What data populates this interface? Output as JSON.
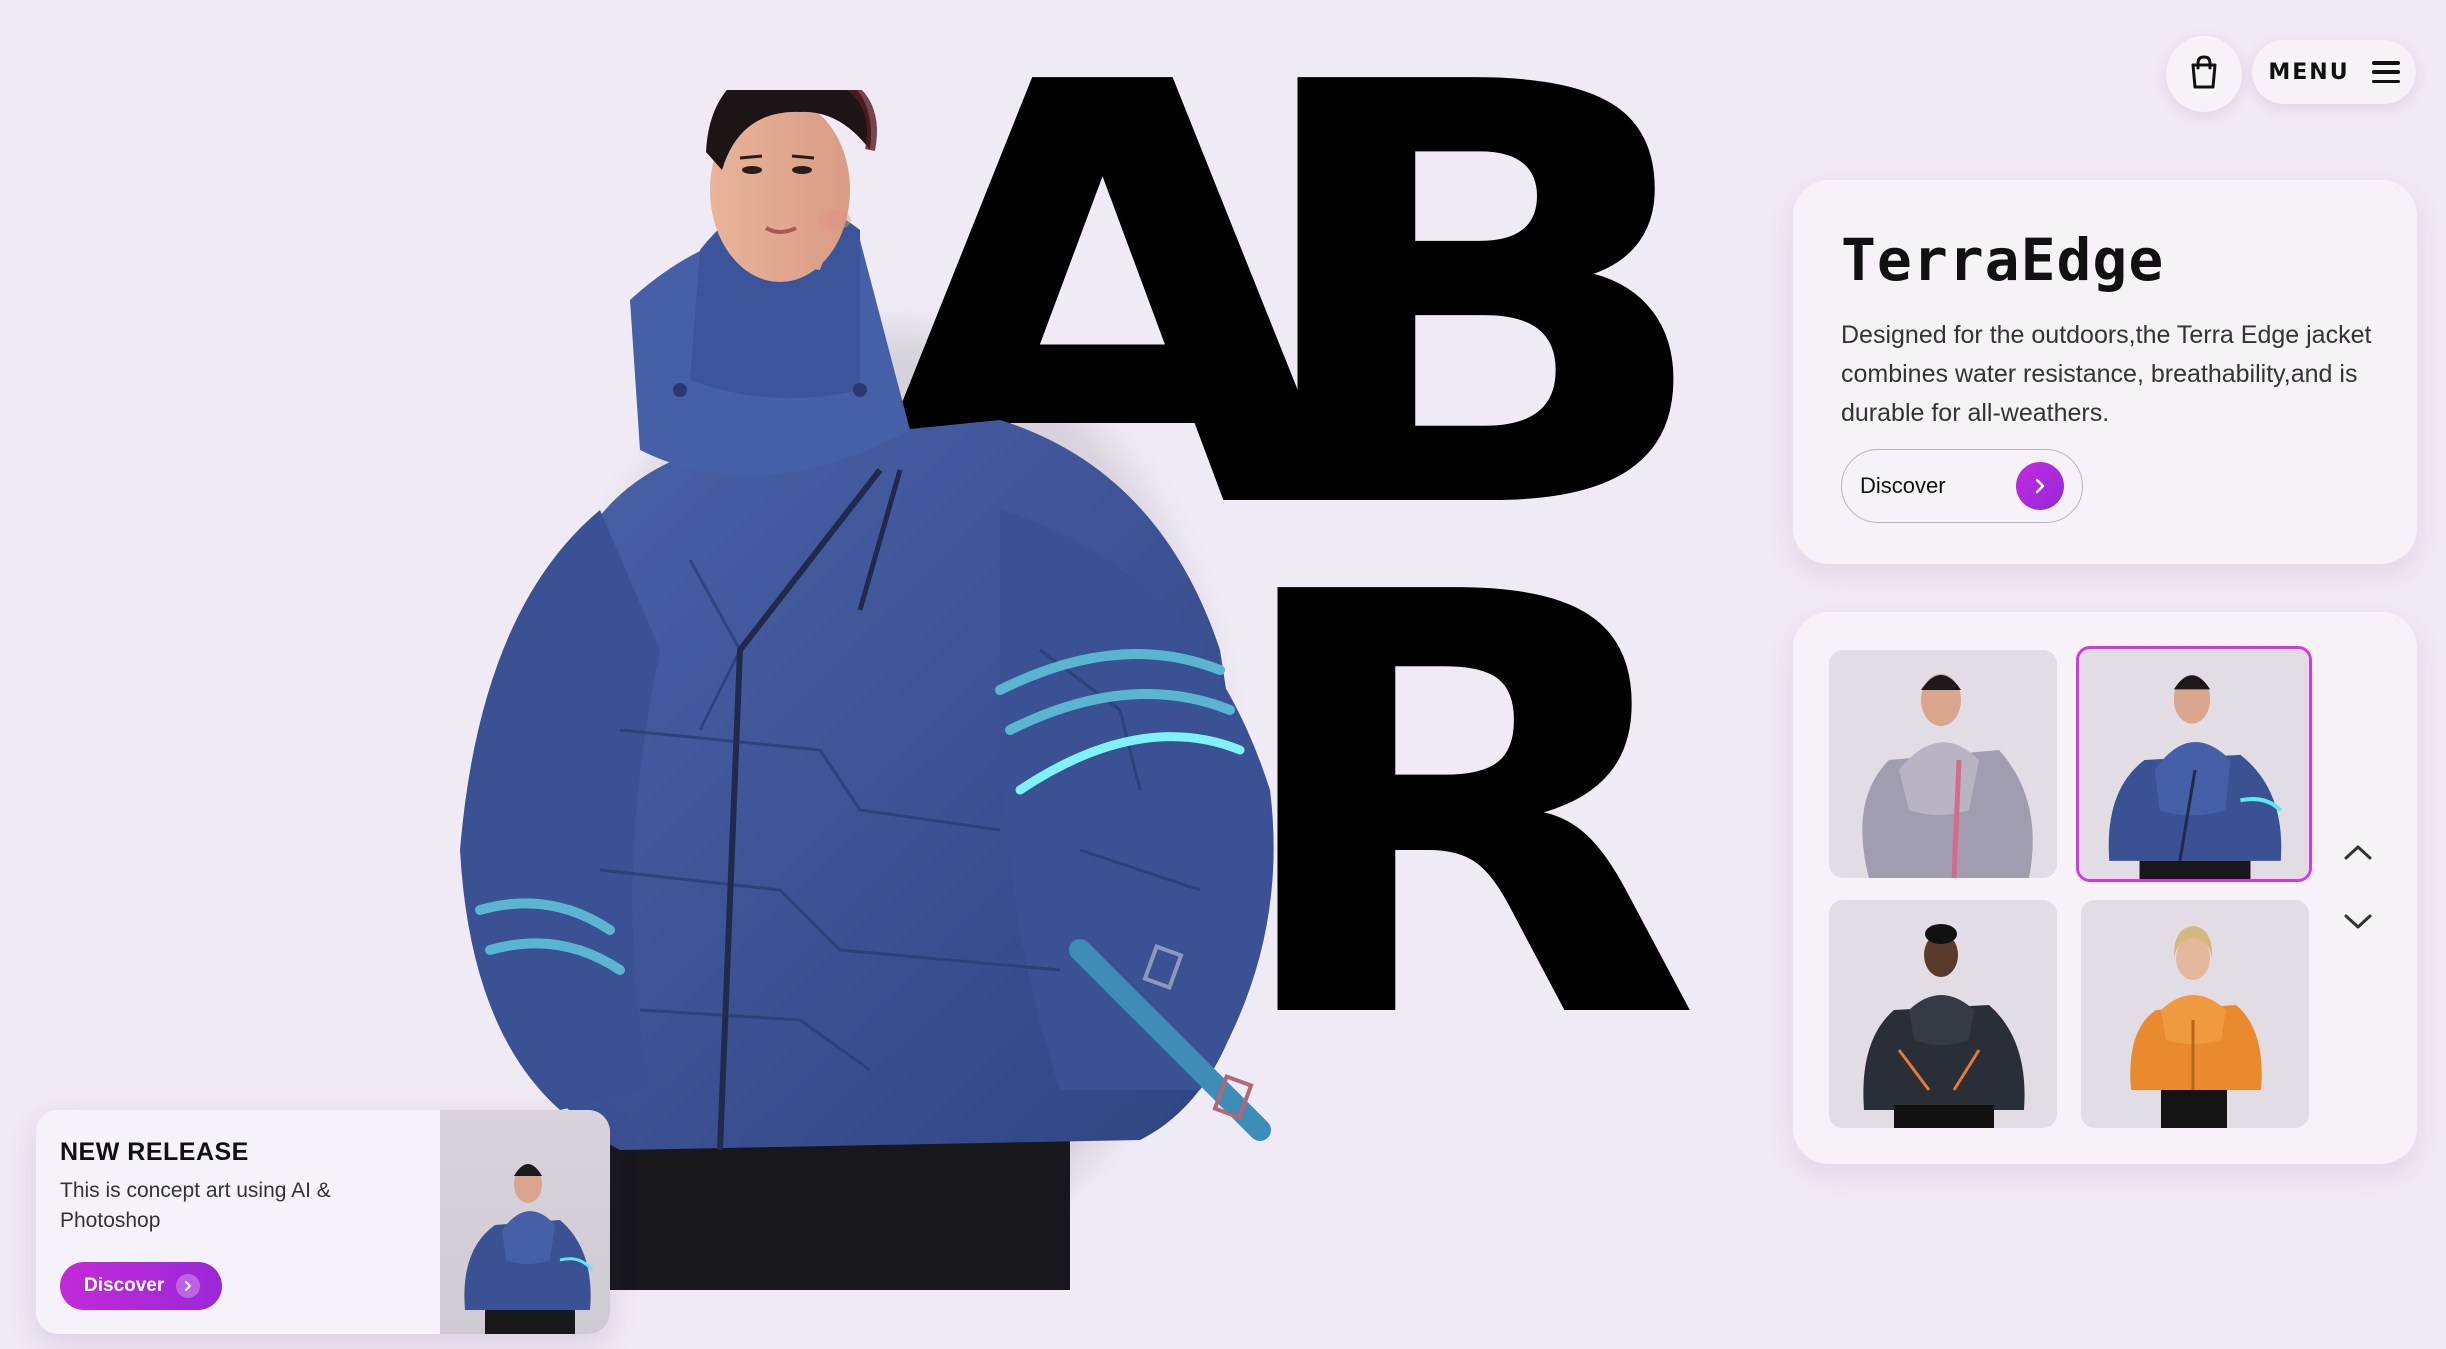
{
  "hero": {
    "letters": [
      "A",
      "B",
      "R"
    ]
  },
  "header": {
    "cart_icon": "shopping-bag-icon",
    "menu_label": "MENU",
    "menu_icon": "hamburger-icon"
  },
  "product": {
    "title": "TerraEdge",
    "description": "Designed for the outdoors,the Terra Edge jacket combines water resistance, breathability,and is durable for all-weathers.",
    "discover_label": "Discover"
  },
  "gallery": {
    "thumbnails": [
      {
        "label": "grey-puffer-jacket",
        "color": "#9a96a8",
        "active": false
      },
      {
        "label": "blue-tech-puffer-jacket",
        "color": "#3b5290",
        "active": true
      },
      {
        "label": "black-puffer-jacket",
        "color": "#2a2e36",
        "active": false
      },
      {
        "label": "orange-puffer-jacket",
        "color": "#e98a2e",
        "active": false
      }
    ],
    "active_border_color": "#d03ae6",
    "up_icon": "chevron-up-icon",
    "down_icon": "chevron-down-icon"
  },
  "release": {
    "title": "NEW RELEASE",
    "description": "This is concept art using AI & Photoshop",
    "discover_label": "Discover"
  },
  "colors": {
    "background": "#f0eaf4",
    "accent": "#b42adc",
    "jacket_blue": "#3d5396",
    "glow": "#5ee8f0"
  }
}
